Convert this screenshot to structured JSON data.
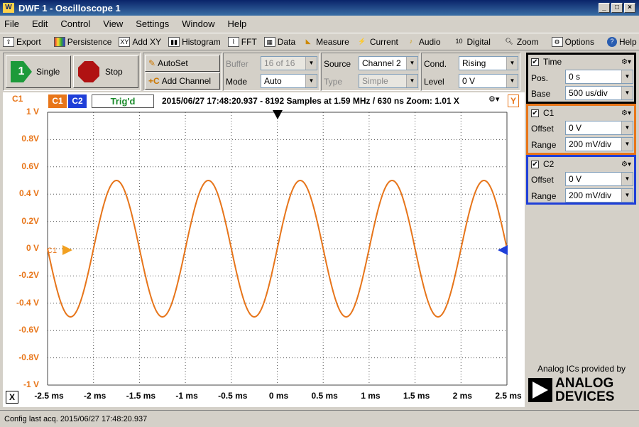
{
  "window": {
    "title": "DWF 1 - Oscilloscope 1",
    "logo": "W"
  },
  "menu": [
    "File",
    "Edit",
    "Control",
    "View",
    "Settings",
    "Window",
    "Help"
  ],
  "toolbar": [
    {
      "icon": "export-icon",
      "label": "Export"
    },
    {
      "icon": "persistence-icon",
      "label": "Persistence"
    },
    {
      "icon": "add-xy-icon",
      "label": "Add XY"
    },
    {
      "icon": "histogram-icon",
      "label": "Histogram"
    },
    {
      "icon": "fft-icon",
      "label": "FFT"
    },
    {
      "icon": "data-icon",
      "label": "Data"
    },
    {
      "icon": "measure-icon",
      "label": "Measure"
    },
    {
      "icon": "current-icon",
      "label": "Current"
    },
    {
      "icon": "audio-icon",
      "label": "Audio"
    },
    {
      "icon": "digital-icon",
      "label": "Digital"
    },
    {
      "icon": "zoom-icon",
      "label": "Zoom"
    },
    {
      "icon": "options-icon",
      "label": "Options"
    },
    {
      "icon": "help-icon",
      "label": "Help"
    }
  ],
  "control": {
    "single_label": "Single",
    "single_badge": "1",
    "stop_label": "Stop",
    "autoset_label": "AutoSet",
    "add_channel_label": "Add Channel",
    "buffer_label": "Buffer",
    "buffer_value": "16 of 16",
    "mode_label": "Mode",
    "mode_value": "Auto",
    "source_label": "Source",
    "source_value": "Channel 2",
    "type_label": "Type",
    "type_value": "Simple",
    "cond_label": "Cond.",
    "cond_value": "Rising",
    "level_label": "Level",
    "level_value": "0 V"
  },
  "plot": {
    "c1_tab": "C1",
    "c2_tab": "C2",
    "axis_channel": "C1",
    "status": "Trig'd",
    "info": "2015/06/27 17:48:20.937 - 8192 Samples at 1.59 MHz / 630 ns Zoom: 1.01 X",
    "y_marker": "Y",
    "x_marker": "X",
    "c1_marker": "C1",
    "colors": {
      "c1": "#e8761a",
      "c2": "#1f3fd8",
      "status": "#1a8a2a"
    }
  },
  "chart_data": {
    "type": "line",
    "y_ticks": [
      "1 V",
      "0.8V",
      "0.6V",
      "0.4 V",
      "0.2V",
      "0 V",
      "-0.2V",
      "-0.4 V",
      "-0.6V",
      "-0.8V",
      "-1 V"
    ],
    "x_ticks": [
      "-2.5 ms",
      "-2 ms",
      "-1.5 ms",
      "-1 ms",
      "-0.5 ms",
      "0 ms",
      "0.5 ms",
      "1 ms",
      "1.5 ms",
      "2 ms",
      "2.5 ms"
    ],
    "xlim": [
      -2.5,
      2.5
    ],
    "ylim": [
      -1,
      1
    ],
    "grid": true,
    "series": [
      {
        "name": "C1",
        "waveform": "sine",
        "amplitude": 0.5,
        "period_ms": 1.0,
        "phase": "rising zero crossing at 0 ms"
      },
      {
        "name": "C2",
        "waveform": "sine",
        "amplitude": 0.5,
        "period_ms": 1.0,
        "phase": "rising zero crossing at 0 ms"
      }
    ]
  },
  "time_panel": {
    "title": "Time",
    "pos_label": "Pos.",
    "pos_value": "0 s",
    "base_label": "Base",
    "base_value": "500 us/div"
  },
  "c1_panel": {
    "title": "C1",
    "offset_label": "Offset",
    "offset_value": "0 V",
    "range_label": "Range",
    "range_value": "200 mV/div"
  },
  "c2_panel": {
    "title": "C2",
    "offset_label": "Offset",
    "offset_value": "0 V",
    "range_label": "Range",
    "range_value": "200 mV/div"
  },
  "branding": {
    "caption": "Analog ICs provided by",
    "brand_line1": "ANALOG",
    "brand_line2": "DEVICES"
  },
  "status_bar": {
    "text": "Config last acq. 2015/06/27  17:48:20.937"
  }
}
